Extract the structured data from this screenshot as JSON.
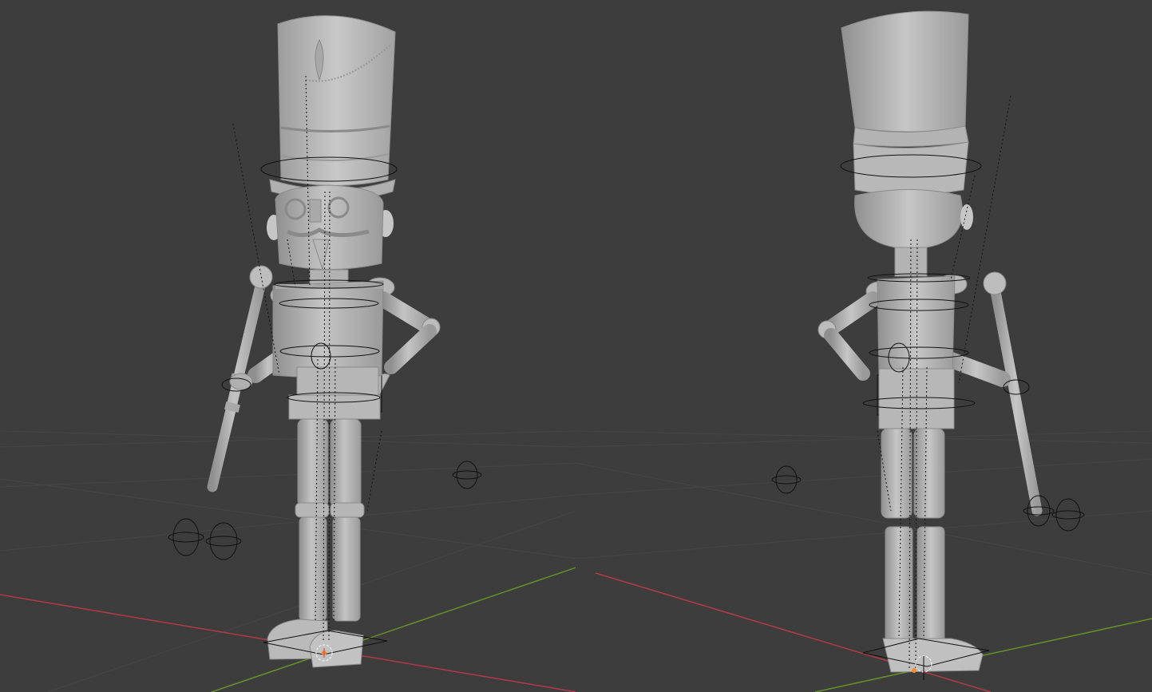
{
  "app": {
    "title": ""
  },
  "viewports": [
    {
      "id": "front-view",
      "header_text": ""
    },
    {
      "id": "back-view",
      "header_text": ""
    }
  ],
  "scene": {
    "object": "nutcracker-soldier",
    "colors": {
      "background": "#3d3d3d",
      "grid": "#4a4a4a",
      "x_axis": "#c0394e",
      "y_axis": "#6e9a2c",
      "mesh": "#b4b4b4",
      "mesh_shadow": "#8d8d8d",
      "mesh_light": "#cfcfcf",
      "wire": "#111111",
      "origin": "#ff8c2a"
    }
  }
}
